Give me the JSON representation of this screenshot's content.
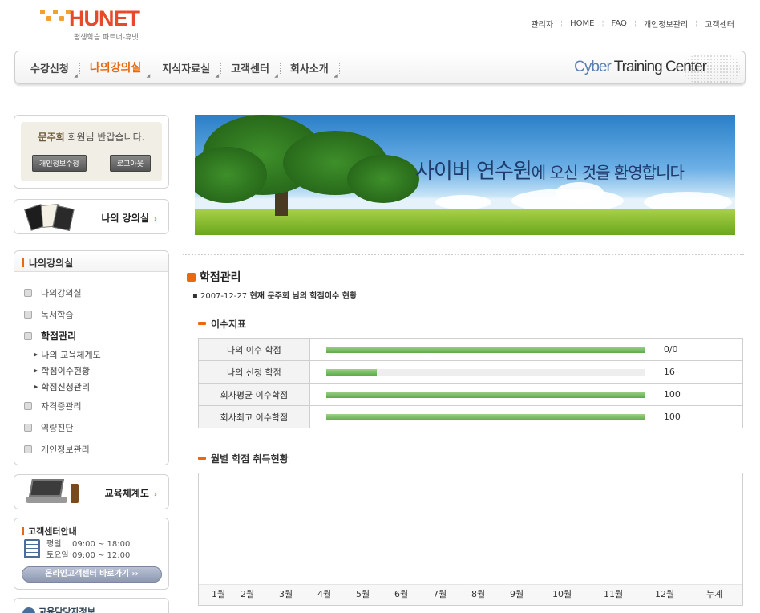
{
  "brand": {
    "name": "HUNET",
    "tagline": "평생학습 파트너-휴넷"
  },
  "topnav": [
    "관리자",
    "HOME",
    "FAQ",
    "개인정보관리",
    "고객센터"
  ],
  "mainnav": {
    "items": [
      "수강신청",
      "나의강의실",
      "지식자료실",
      "고객센터",
      "회사소개"
    ],
    "active": "나의강의실",
    "ctc_a": "Cyber ",
    "ctc_b": "Training Center"
  },
  "welcome": {
    "name": "문주희",
    "greeting": " 회원님 반갑습니다.",
    "edit_button": "개인정보수정",
    "logout_button": "로그아웃"
  },
  "my_room_link": "나의 강의실",
  "sidebar": {
    "title": "나의강의실",
    "items": [
      {
        "label": "나의강의실"
      },
      {
        "label": "독서학습"
      },
      {
        "label": "학점관리"
      },
      {
        "label": "나의 교육체계도"
      },
      {
        "label": "학점이수현황"
      },
      {
        "label": "학점신청관리"
      },
      {
        "label": "자격증관리"
      },
      {
        "label": "역량진단"
      },
      {
        "label": "개인정보관리"
      }
    ]
  },
  "edu_system_link": "교육체계도",
  "cs": {
    "title": "고객센터안내",
    "weekday_label": "평일",
    "weekday_hours": "09:00 ~ 18:00",
    "saturday_label": "토요일",
    "saturday_hours": "09:00 ~ 12:00",
    "go_button": "온라인고객센터 바로가기 ››"
  },
  "staff_title": "교육담당자정보",
  "banner": {
    "message_strong": "사이버 연수원",
    "message_rest": "에 오신 것을 환영합니다"
  },
  "page": {
    "title": "학점관리",
    "date": "2007-12-27",
    "status": " 현재 문주희 님의 학점이수 현황"
  },
  "credits": {
    "title": "이수지표",
    "rows": [
      {
        "label": "나의 이수 학점",
        "fill": 1.0,
        "value": "0/0"
      },
      {
        "label": "나의 신청 학점",
        "fill": 0.16,
        "value": "16"
      },
      {
        "label": "회사평균 이수학점",
        "fill": 1.0,
        "value": "100"
      },
      {
        "label": "회사최고 이수학점",
        "fill": 1.0,
        "value": "100"
      }
    ]
  },
  "monthly": {
    "title": "월별 학점 취득현황",
    "months": [
      "1월",
      "2월",
      "3월",
      "4월",
      "5월",
      "6월",
      "7월",
      "8월",
      "9월",
      "10월",
      "11월",
      "12월",
      "누계"
    ]
  },
  "colors": {
    "accent": "#e86a10",
    "bar": "#6fb35a",
    "logo": "#e8492a"
  }
}
